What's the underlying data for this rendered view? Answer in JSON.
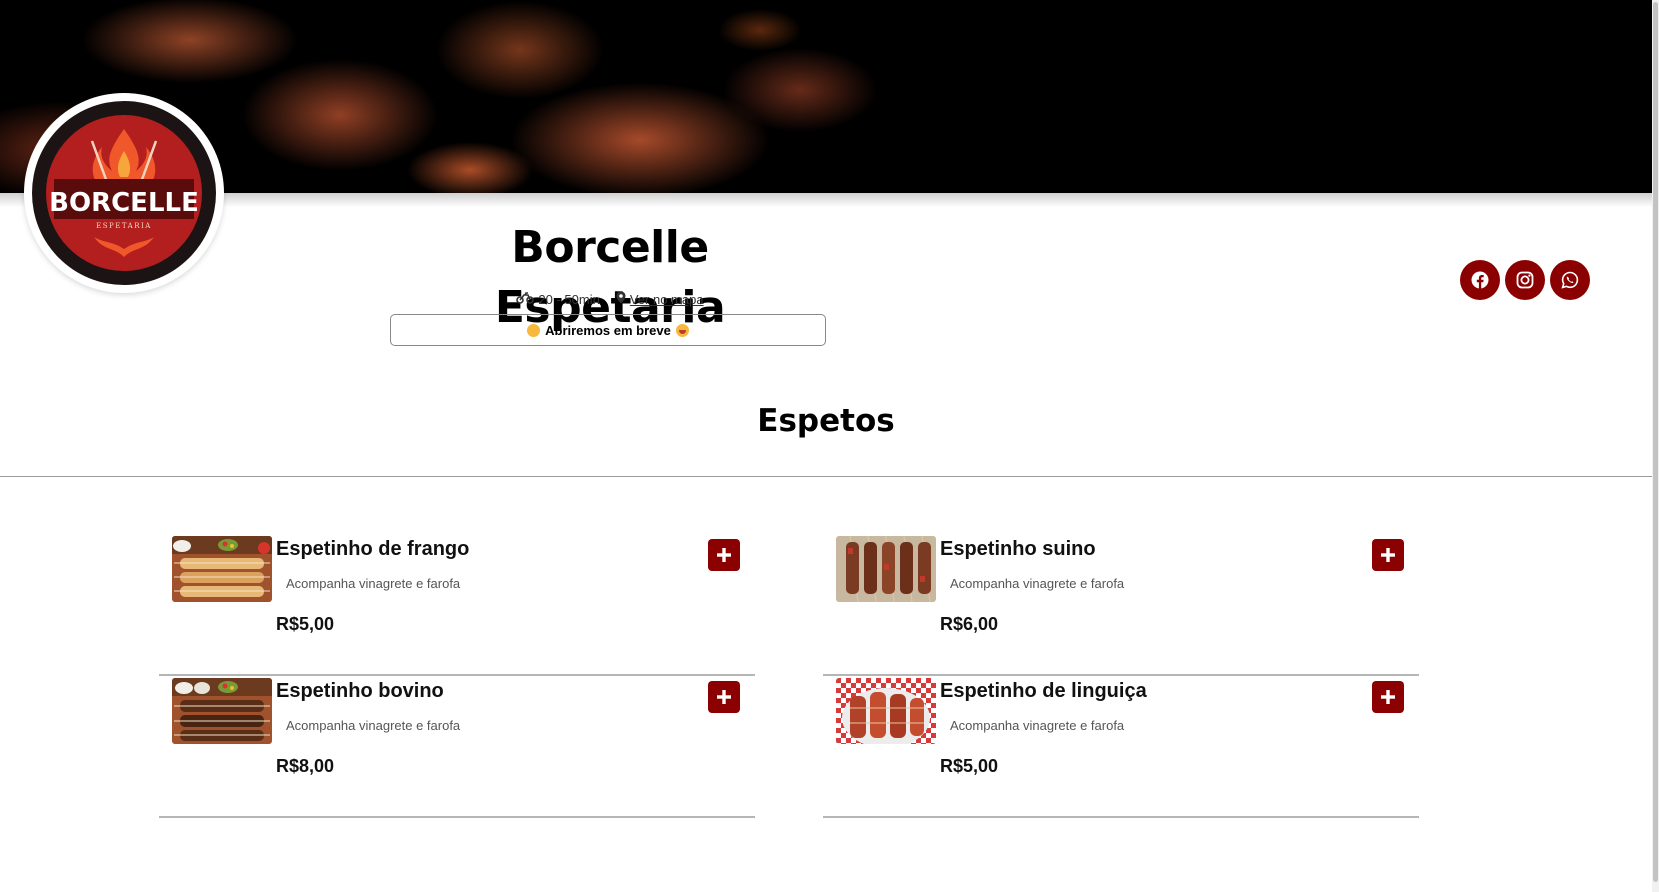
{
  "restaurant": {
    "logo_text": "BORCELLE",
    "logo_subtext": "ESPETARIA",
    "name": "Borcelle Espetaria",
    "delivery_time": "20 - 50min",
    "map_link": "Ver no mapa",
    "status": "Abriremos em breve"
  },
  "socials": [
    {
      "name": "facebook",
      "icon": "facebook-icon"
    },
    {
      "name": "instagram",
      "icon": "instagram-icon"
    },
    {
      "name": "whatsapp",
      "icon": "whatsapp-icon"
    }
  ],
  "menu": {
    "section_title": "Espetos",
    "items": [
      {
        "name": "Espetinho de frango",
        "description": "Acompanha vinagrete e farofa",
        "price": "R$5,00"
      },
      {
        "name": "Espetinho suino",
        "description": "Acompanha vinagrete e farofa",
        "price": "R$6,00"
      },
      {
        "name": "Espetinho bovino",
        "description": "Acompanha vinagrete e farofa",
        "price": "R$8,00"
      },
      {
        "name": "Espetinho de linguiça",
        "description": "Acompanha vinagrete e farofa",
        "price": "R$5,00"
      }
    ]
  },
  "colors": {
    "accent": "#8b0000",
    "status_dot": "#f6b93b",
    "divider": "#b5b5b5"
  }
}
